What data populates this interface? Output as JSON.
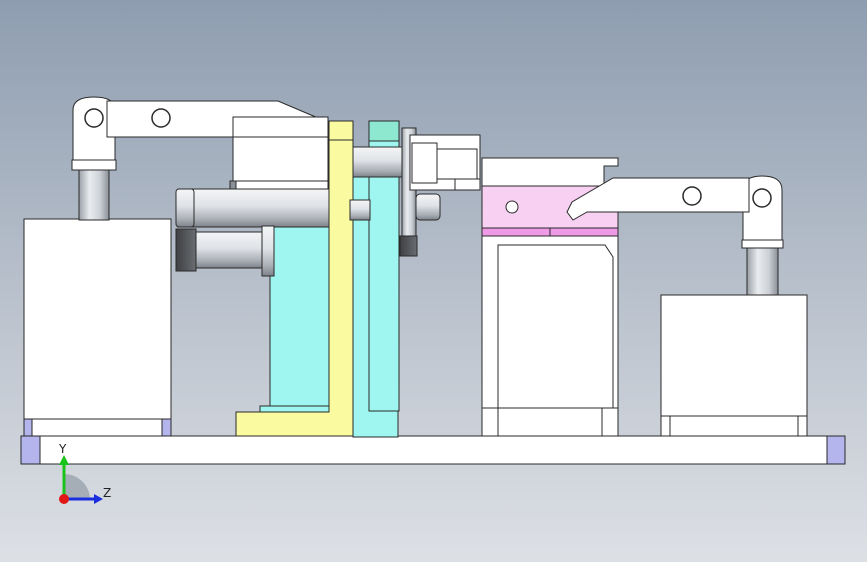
{
  "viewport": {
    "background_top": "#8e9db0",
    "background_bottom": "#dde0e5"
  },
  "colors": {
    "part_white": "#ffffff",
    "edge": "#2a2a2a",
    "bracket_yellow": "#fafaa0",
    "block_cyan": "#9ff5ef",
    "block_teal": "#8ee8d0",
    "pad_pink": "#f7d0f2",
    "pad_pink_dark": "#ef9ae6",
    "corner_blue": "#b3b5ec",
    "cylinder_light": "#eef0f3",
    "cylinder_dark": "#8a8f96",
    "rod_dark": "#4a4d50"
  },
  "triad": {
    "y_label": "Y",
    "z_label": "Z",
    "y_color": "#19c319",
    "z_color": "#1a2ee0",
    "origin_color": "#e01818"
  }
}
